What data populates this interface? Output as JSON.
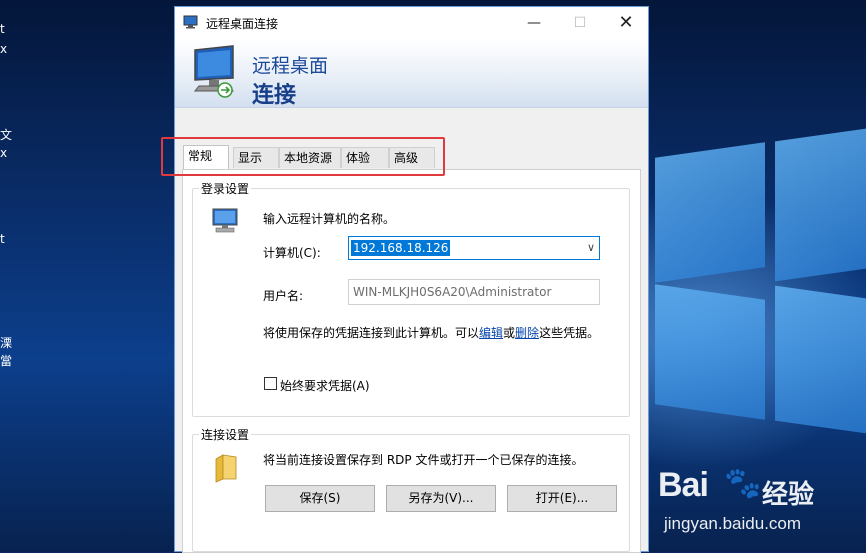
{
  "desktop": {
    "side_labels": [
      "t",
      "x",
      "文",
      "x",
      "t",
      "溧",
      "當"
    ],
    "watermark": {
      "brand": "Bai",
      "brand_cn": "经验",
      "url": "jingyan.baidu.com"
    }
  },
  "window": {
    "title": "远程桌面连接",
    "controls": {
      "minimize": "—",
      "maximize": "☐",
      "close": "✕"
    },
    "banner": {
      "line1": "远程桌面",
      "line2": "连接"
    }
  },
  "tabs": [
    {
      "label": "常规",
      "active": true
    },
    {
      "label": "显示",
      "active": false
    },
    {
      "label": "本地资源",
      "active": false
    },
    {
      "label": "体验",
      "active": false
    },
    {
      "label": "高级",
      "active": false
    }
  ],
  "login_group": {
    "title": "登录设置",
    "prompt": "输入远程计算机的名称。",
    "computer_label": "计算机(C):",
    "computer_value": "192.168.18.126",
    "username_label": "用户名:",
    "username_value": "WIN-MLKJH0S6A20\\Administrator",
    "saved_cred_prefix": "将使用保存的凭据连接到此计算机。可以",
    "edit_link": "编辑",
    "or_text": "或",
    "delete_link": "删除",
    "saved_cred_suffix": "这些凭据。",
    "always_ask_label": "始终要求凭据(A)",
    "always_ask_checked": false
  },
  "connection_group": {
    "title": "连接设置",
    "description": "将当前连接设置保存到 RDP 文件或打开一个已保存的连接。",
    "buttons": {
      "save": "保存(S)",
      "save_as": "另存为(V)...",
      "open": "打开(E)..."
    }
  },
  "colors": {
    "accent": "#0078d7",
    "highlight_box": "#e0393e",
    "banner_text": "#1c4a9a"
  }
}
